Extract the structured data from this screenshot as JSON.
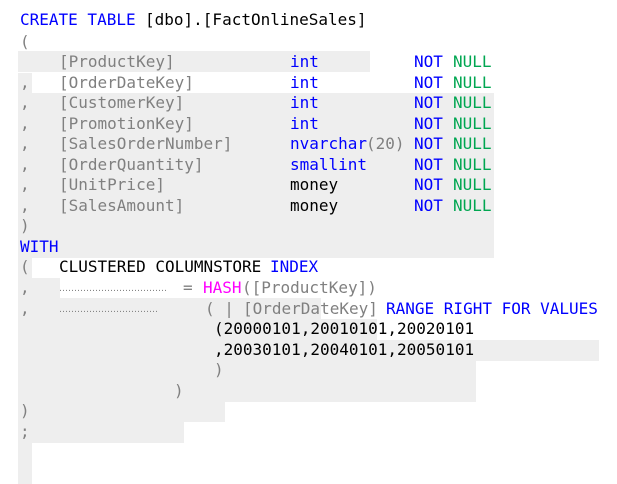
{
  "header": {
    "create": "CREATE TABLE",
    "table_name": "[dbo].[FactOnlineSales]"
  },
  "open_paren": "(",
  "columns": [
    {
      "prefix": "",
      "name": "[ProductKey]",
      "type": "int",
      "not": "NOT",
      "null": "NULL"
    },
    {
      "prefix": ",",
      "name": "[OrderDateKey]",
      "type": "int",
      "not": "NOT",
      "null": "NULL"
    },
    {
      "prefix": ",",
      "name": "[CustomerKey]",
      "type": "int",
      "not": "NOT",
      "null": "NULL"
    },
    {
      "prefix": ",",
      "name": "[PromotionKey]",
      "type": "int",
      "not": "NOT",
      "null": "NULL"
    },
    {
      "prefix": ",",
      "name": "[SalesOrderNumber]",
      "type": "nvarchar",
      "type_arg": "(20)",
      "not": "NOT",
      "null": "NULL"
    },
    {
      "prefix": ",",
      "name": "[OrderQuantity]",
      "type": "smallint",
      "not": "NOT",
      "null": "NULL"
    },
    {
      "prefix": ",",
      "name": "[UnitPrice]",
      "type": "money",
      "not": "NOT",
      "null": "NULL"
    },
    {
      "prefix": ",",
      "name": "[SalesAmount]",
      "type": "money",
      "not": "NOT",
      "null": "NULL"
    }
  ],
  "close_paren": ")",
  "with_kw": "WITH",
  "index_line": {
    "paren": "(",
    "clustered": "CLUSTERED COLUMNSTORE",
    "index_kw": "INDEX"
  },
  "dist_line": {
    "comma": ",",
    "dots": "………………………………",
    "equals": "=",
    "hash_kw": "HASH",
    "hash_arg": "([ProductKey])"
  },
  "part_line": {
    "comma": ",",
    "dots": "……………………………",
    "paren": "( |",
    "column": "[OrderDateKey]",
    "range_kw": "RANGE RIGHT FOR VALUES"
  },
  "values_1": "(20000101,20010101,20020101",
  "values_2": ",20030101,20040101,20050101",
  "values_close": ")",
  "part_close": ")",
  "final_paren": ")",
  "semicolon": ";"
}
